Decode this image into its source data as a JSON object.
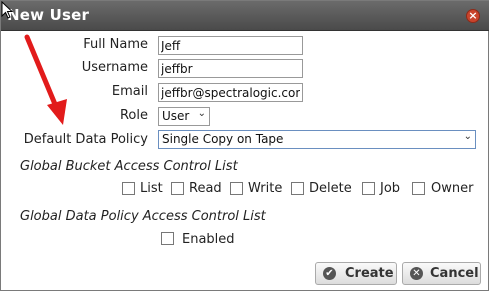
{
  "dialog": {
    "title": "New User"
  },
  "form": {
    "full_name": {
      "label": "Full Name",
      "value": "Jeff"
    },
    "username": {
      "label": "Username",
      "value": "jeffbr"
    },
    "email": {
      "label": "Email",
      "value": "jeffbr@spectralogic.com"
    },
    "role": {
      "label": "Role",
      "value": "User"
    },
    "default_data_policy": {
      "label": "Default Data Policy",
      "value": "Single Copy on Tape"
    }
  },
  "bucket_acl": {
    "title": "Global Bucket Access Control List",
    "options": [
      "List",
      "Read",
      "Write",
      "Delete",
      "Job",
      "Owner"
    ]
  },
  "policy_acl": {
    "title": "Global Data Policy Access Control List",
    "enabled_label": "Enabled"
  },
  "buttons": {
    "create": "Create",
    "cancel": "Cancel"
  },
  "colors": {
    "titlebar": "#555555",
    "arrow": "#e21b1b",
    "close": "#c9442c",
    "create_icon": "#555555",
    "cancel_icon": "#555555"
  },
  "icons": {
    "close": "close-icon",
    "create": "check-icon",
    "cancel": "cancel-icon",
    "cursor": "mouse-cursor-icon",
    "annotation": "red-arrow-annotation"
  }
}
